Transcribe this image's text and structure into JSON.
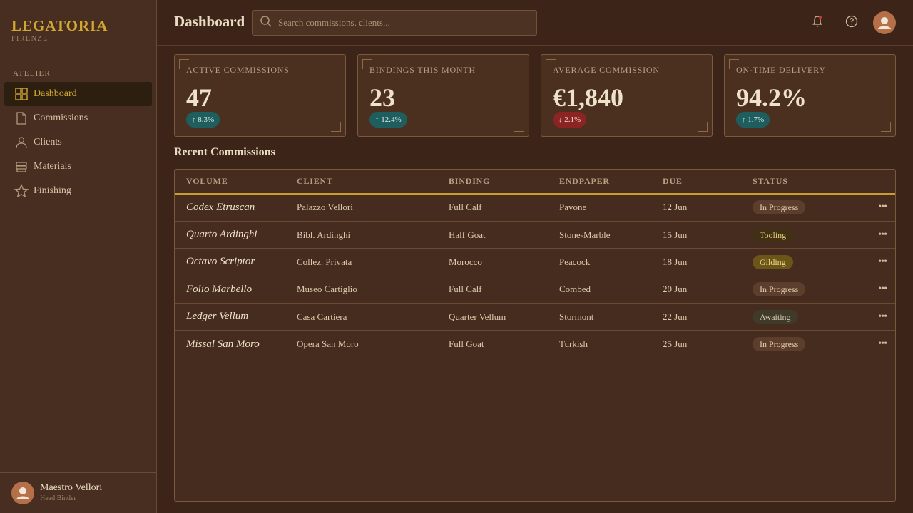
{
  "brand": {
    "title": "LEGATORIA",
    "subtitle": "FIRENZE"
  },
  "sidebar": {
    "section": "ATELIER",
    "items": [
      {
        "label": "Dashboard",
        "icon": "grid-icon",
        "active": true
      },
      {
        "label": "Commissions",
        "icon": "document-icon",
        "active": false
      },
      {
        "label": "Clients",
        "icon": "person-icon",
        "active": false
      },
      {
        "label": "Materials",
        "icon": "stack-icon",
        "active": false
      },
      {
        "label": "Finishing",
        "icon": "star-icon",
        "active": false
      }
    ],
    "user": {
      "name": "Maestro Vellori",
      "role": "Head Binder"
    }
  },
  "header": {
    "title": "Dashboard",
    "search_placeholder": "Search commissions, clients...",
    "notification_dot_color": "#c0392b"
  },
  "kpis": [
    {
      "label": "ACTIVE COMMISSIONS",
      "value": "47",
      "delta": "↑ 8.3%",
      "trend": "up"
    },
    {
      "label": "BINDINGS THIS MONTH",
      "value": "23",
      "delta": "↑ 12.4%",
      "trend": "up"
    },
    {
      "label": "AVERAGE COMMISSION",
      "value": "€1,840",
      "delta": "↓ 2.1%",
      "trend": "down"
    },
    {
      "label": "ON-TIME DELIVERY",
      "value": "94.2%",
      "delta": "↑ 1.7%",
      "trend": "up"
    }
  ],
  "recent": {
    "title": "Recent Commissions",
    "columns": [
      "VOLUME",
      "CLIENT",
      "BINDING",
      "ENDPAPER",
      "DUE",
      "STATUS"
    ],
    "rows": [
      {
        "volume": "Codex Etruscan",
        "client": "Palazzo Vellori",
        "binding": "Full Calf",
        "endpaper": "Pavone",
        "due": "12 Jun",
        "status": "In Progress",
        "status_kind": "progress"
      },
      {
        "volume": "Quarto Ardinghi",
        "client": "Bibl. Ardinghi",
        "binding": "Half Goat",
        "endpaper": "Stone-Marble",
        "due": "15 Jun",
        "status": "Tooling",
        "status_kind": "tooling"
      },
      {
        "volume": "Octavo Scriptor",
        "client": "Collez. Privata",
        "binding": "Morocco",
        "endpaper": "Peacock",
        "due": "18 Jun",
        "status": "Gilding",
        "status_kind": "gilding"
      },
      {
        "volume": "Folio Marbello",
        "client": "Museo Cartiglio",
        "binding": "Full Calf",
        "endpaper": "Combed",
        "due": "20 Jun",
        "status": "In Progress",
        "status_kind": "progress"
      },
      {
        "volume": "Ledger Vellum",
        "client": "Casa Cartiera",
        "binding": "Quarter Vellum",
        "endpaper": "Stormont",
        "due": "22 Jun",
        "status": "Awaiting",
        "status_kind": "awaiting"
      },
      {
        "volume": "Missal San Moro",
        "client": "Opera San Moro",
        "binding": "Full Goat",
        "endpaper": "Turkish",
        "due": "25 Jun",
        "status": "In Progress",
        "status_kind": "progress"
      }
    ],
    "row_action_icon": "more-horizontal-icon"
  },
  "colors": {
    "accent_gold": "#d3a832",
    "bg": "#3c2419",
    "card": "#4b3020",
    "delta_up": "#1f5e5f",
    "delta_down": "#8c2424"
  }
}
